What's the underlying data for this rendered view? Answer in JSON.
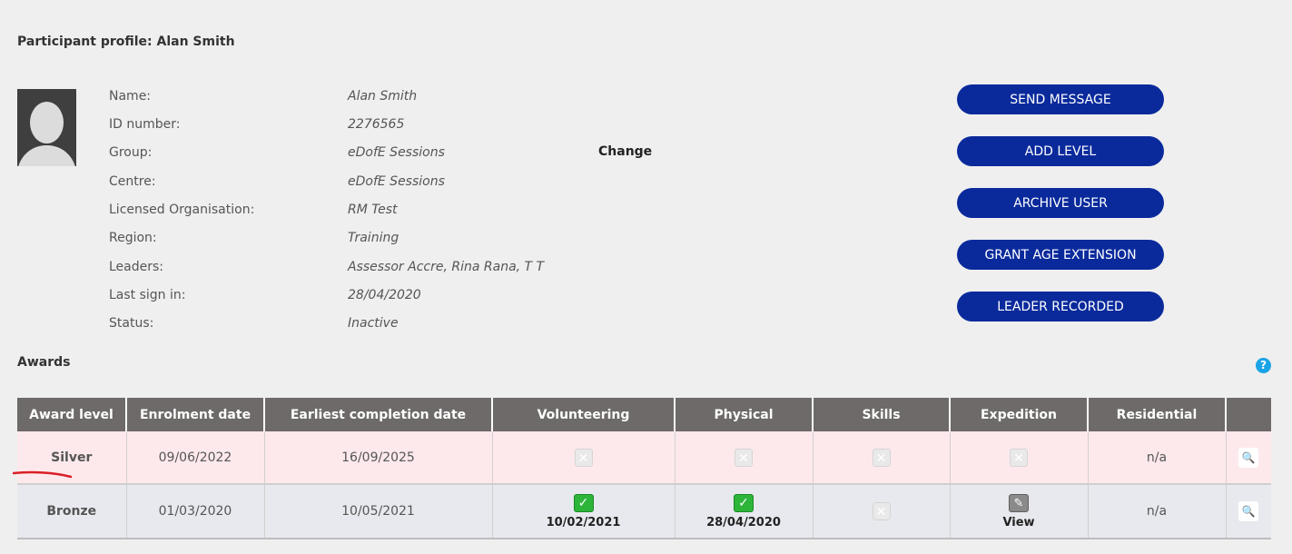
{
  "profile": {
    "title": "Participant profile: Alan Smith",
    "fields": [
      {
        "label": "Name:",
        "value": "Alan Smith"
      },
      {
        "label": "ID number:",
        "value": "2276565"
      },
      {
        "label": "Group:",
        "value": "eDofE Sessions"
      },
      {
        "label": "Centre:",
        "value": "eDofE Sessions"
      },
      {
        "label": "Licensed Organisation:",
        "value": "RM Test"
      },
      {
        "label": "Region:",
        "value": "Training"
      },
      {
        "label": "Leaders:",
        "value": "Assessor Accre, Rina Rana, T T"
      },
      {
        "label": "Last sign in:",
        "value": "28/04/2020"
      },
      {
        "label": "Status:",
        "value": "Inactive"
      }
    ],
    "change_label": "Change"
  },
  "actions": {
    "send_message": "SEND MESSAGE",
    "add_level": "ADD LEVEL",
    "archive_user": "ARCHIVE USER",
    "grant_age_extension": "GRANT AGE EXTENSION",
    "leader_recorded": "LEADER RECORDED"
  },
  "awards": {
    "title": "Awards",
    "help_icon": "?",
    "columns": [
      "Award level",
      "Enrolment date",
      "Earliest completion date",
      "Volunteering",
      "Physical",
      "Skills",
      "Expedition",
      "Residential",
      ""
    ],
    "rows": [
      {
        "level": "Silver",
        "enrolment": "09/06/2022",
        "earliest": "16/09/2025",
        "volunteering": {
          "icon": "x-icon",
          "label": ""
        },
        "physical": {
          "icon": "x-icon",
          "label": ""
        },
        "skills": {
          "icon": "x-icon",
          "label": ""
        },
        "expedition": {
          "icon": "x-icon",
          "label": ""
        },
        "residential": "n/a"
      },
      {
        "level": "Bronze",
        "enrolment": "01/03/2020",
        "earliest": "10/05/2021",
        "volunteering": {
          "icon": "check-icon",
          "label": "10/02/2021"
        },
        "physical": {
          "icon": "check-icon",
          "label": "28/04/2020"
        },
        "skills": {
          "icon": "x-icon",
          "label": ""
        },
        "expedition": {
          "icon": "edit-icon",
          "label": "View"
        },
        "residential": "n/a"
      }
    ]
  },
  "colors": {
    "button": "#0a2a9c",
    "header": "#6d6a69",
    "silver_row": "#fde9ec",
    "bronze_row": "#e8e9ee",
    "check": "#2db53a",
    "help": "#1ba3e6"
  }
}
